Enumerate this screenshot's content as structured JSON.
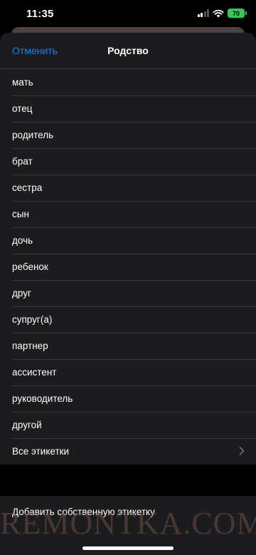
{
  "status_bar": {
    "time": "11:35",
    "battery": "70"
  },
  "nav": {
    "cancel_label": "Отменить",
    "title": "Родство"
  },
  "items": [
    {
      "label": "мать"
    },
    {
      "label": "отец"
    },
    {
      "label": "родитель"
    },
    {
      "label": "брат"
    },
    {
      "label": "сестра"
    },
    {
      "label": "сын"
    },
    {
      "label": "дочь"
    },
    {
      "label": "ребенок"
    },
    {
      "label": "друг"
    },
    {
      "label": "супруг(а)"
    },
    {
      "label": "партнер"
    },
    {
      "label": "ассистент"
    },
    {
      "label": "руководитель"
    },
    {
      "label": "другой"
    },
    {
      "label": "Все этикетки"
    }
  ],
  "add_custom_label": "Добавить собственную этикетку",
  "watermark": "REMONTKA.COM",
  "colors": {
    "accent": "#0a84ff",
    "sheet_background": "#1c1c1e",
    "battery": "#34c759"
  }
}
